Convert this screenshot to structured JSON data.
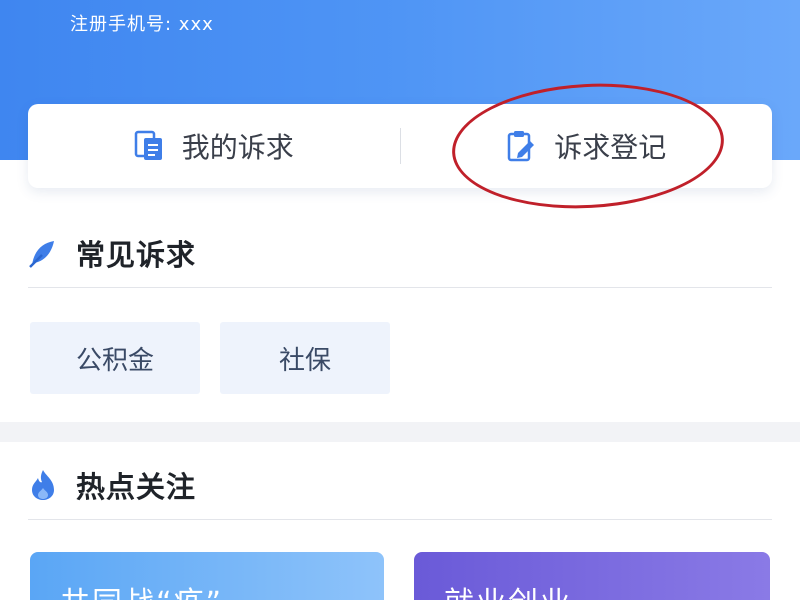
{
  "header": {
    "phone_label": "注册手机号: xxx"
  },
  "tabs": [
    {
      "label": "我的诉求",
      "icon": "document-icon"
    },
    {
      "label": "诉求登记",
      "icon": "clipboard-edit-icon"
    }
  ],
  "common_requests": {
    "title": "常见诉求",
    "icon": "feather-icon",
    "chips": [
      "公积金",
      "社保"
    ]
  },
  "hot_topics": {
    "title": "热点关注",
    "icon": "flame-icon",
    "cards": [
      "共同战“疫”",
      "就业创业"
    ]
  },
  "colors": {
    "header_blue": "#4f95f5",
    "accent_blue": "#3f7ee8",
    "chip_bg": "#eef3fc",
    "annotation_red": "#c0202a"
  }
}
